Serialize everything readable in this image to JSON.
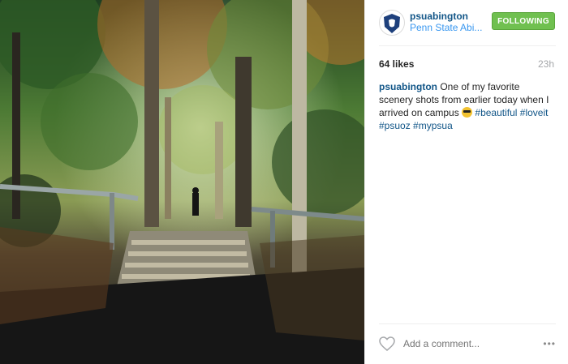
{
  "post": {
    "username": "psuabington",
    "location": "Penn State Abi...",
    "follow_label": "FOLLOWING",
    "likes": "64 likes",
    "time": "23h",
    "caption": {
      "username": "psuabington",
      "text": "One of my favorite scenery shots from earlier today when I arrived on campus",
      "emoji": "sunglasses-emoji",
      "hashtags": [
        "#beautiful",
        "#loveit",
        "#psuoz",
        "#mypsua"
      ]
    },
    "comment_placeholder": "Add a comment...",
    "more_label": "•••"
  },
  "icons": {
    "avatar": "penn-state-nittany-lion-logo",
    "like": "heart-icon",
    "more": "more-options-icon"
  },
  "colors": {
    "username": "#125688",
    "link": "#3897f0",
    "following_button": "#70c050"
  }
}
